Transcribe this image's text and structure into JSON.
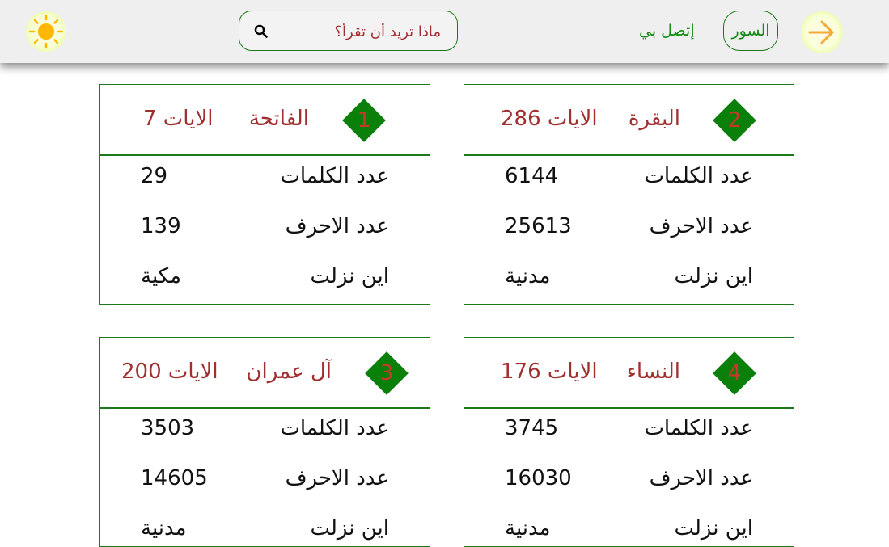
{
  "header": {
    "search_placeholder": "ماذا تريد أن تقرأ؟",
    "nav_contact": "إتصل بي",
    "nav_surahs": "السور",
    "accent_color": "#0a7f0a",
    "text_red": "#a03030"
  },
  "icons": {
    "theme": "sun-icon",
    "back": "arrow-right-icon",
    "search": "search-icon"
  },
  "labels": {
    "words": "عدد الكلمات",
    "letters": "عدد الاحرف",
    "revealed": "اين نزلت"
  },
  "surahs": [
    {
      "number": "1",
      "name": "الفاتحة",
      "ayat": "الايات 7",
      "words": "29",
      "letters": "139",
      "place": "مكية"
    },
    {
      "number": "2",
      "name": "البقرة",
      "ayat": "الايات 286",
      "words": "6144",
      "letters": "25613",
      "place": "مدنية"
    },
    {
      "number": "3",
      "name": "آل عمران",
      "ayat": "الايات 200",
      "words": "3503",
      "letters": "14605",
      "place": "مدنية"
    },
    {
      "number": "4",
      "name": "النساء",
      "ayat": "الايات 176",
      "words": "3745",
      "letters": "16030",
      "place": "مدنية"
    }
  ]
}
